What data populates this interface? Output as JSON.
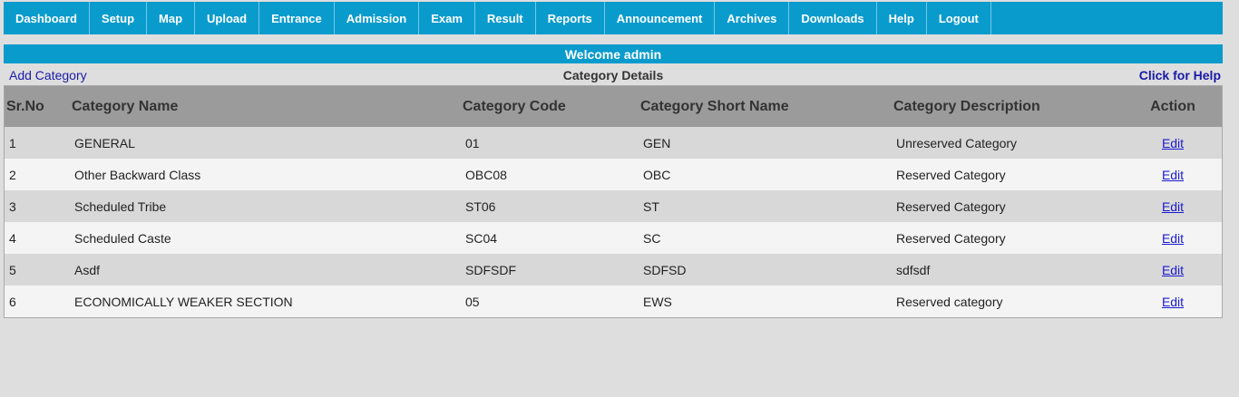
{
  "nav": [
    "Dashboard",
    "Setup",
    "Map",
    "Upload",
    "Entrance",
    "Admission",
    "Exam",
    "Result",
    "Reports",
    "Announcement",
    "Archives",
    "Downloads",
    "Help",
    "Logout"
  ],
  "welcome": "Welcome admin",
  "add_category": "Add Category",
  "page_title": "Category Details",
  "help_link": "Click for Help",
  "table": {
    "headers": [
      "Sr.No",
      "Category Name",
      "Category Code",
      "Category Short Name",
      "Category Description",
      "Action"
    ],
    "rows": [
      [
        "1",
        "GENERAL",
        "01",
        "GEN",
        "Unreserved Category",
        "Edit"
      ],
      [
        "2",
        "Other Backward Class",
        "OBC08",
        "OBC",
        "Reserved Category",
        "Edit"
      ],
      [
        "3",
        "Scheduled Tribe",
        "ST06",
        "ST",
        "Reserved Category",
        "Edit"
      ],
      [
        "4",
        "Scheduled Caste",
        "SC04",
        "SC",
        "Reserved Category",
        "Edit"
      ],
      [
        "5",
        "Asdf",
        "SDFSDF",
        "SDFSD",
        "sdfsdf",
        "Edit"
      ],
      [
        "6",
        "ECONOMICALLY WEAKER SECTION",
        "05",
        "EWS",
        "Reserved category",
        "Edit"
      ]
    ]
  },
  "colors": {
    "accent": "#0a9bcd",
    "header_bg": "#9b9b9b",
    "link": "#1a1aa8"
  }
}
